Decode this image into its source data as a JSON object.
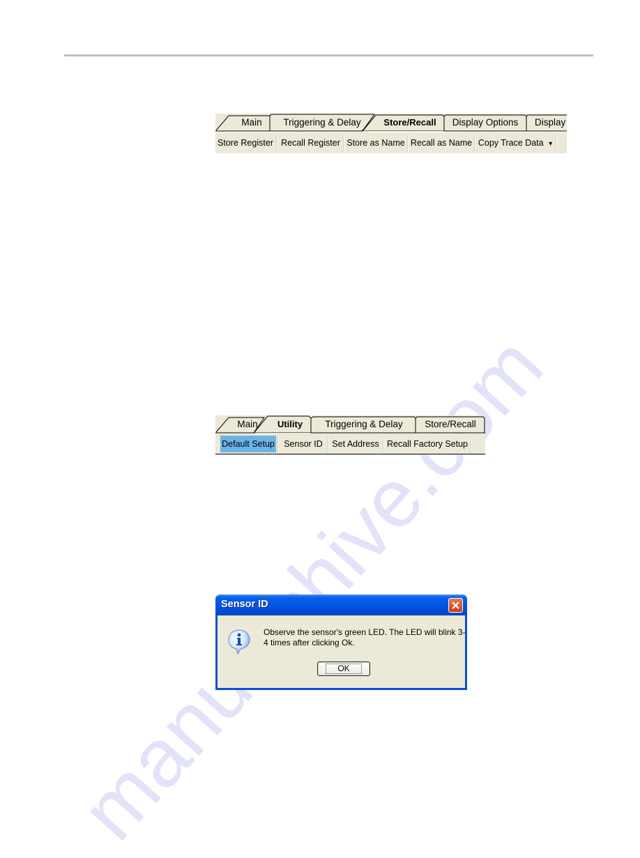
{
  "watermark": "manualshive.com",
  "toolbar_store_recall": {
    "tabs": [
      {
        "label": "Main",
        "active": false
      },
      {
        "label": "Triggering & Delay",
        "active": false
      },
      {
        "label": "Store/Recall",
        "active": true
      },
      {
        "label": "Display Options",
        "active": false
      },
      {
        "label": "Display",
        "active": false
      }
    ],
    "buttons": [
      {
        "label": "Store Register"
      },
      {
        "label": "Recall Register"
      },
      {
        "label": "Store as Name"
      },
      {
        "label": "Recall as Name"
      },
      {
        "label": "Copy Trace Data",
        "dropdown": true
      }
    ],
    "dropdown_glyph": "▾"
  },
  "toolbar_utility": {
    "tabs": [
      {
        "label": "Main",
        "active": false
      },
      {
        "label": "Utility",
        "active": true
      },
      {
        "label": "Triggering & Delay",
        "active": false
      },
      {
        "label": "Store/Recall",
        "active": false
      }
    ],
    "buttons": [
      {
        "label": "Default Setup",
        "highlighted": true
      },
      {
        "label": "Sensor ID"
      },
      {
        "label": "Set Address"
      },
      {
        "label": "Recall Factory Setup"
      }
    ]
  },
  "dialog": {
    "title": "Sensor ID",
    "message": "Observe the sensor's green LED. The LED will blink 3-4 times after clicking Ok.",
    "ok_label": "OK",
    "icon": "info-icon",
    "close_icon": "close-icon"
  }
}
